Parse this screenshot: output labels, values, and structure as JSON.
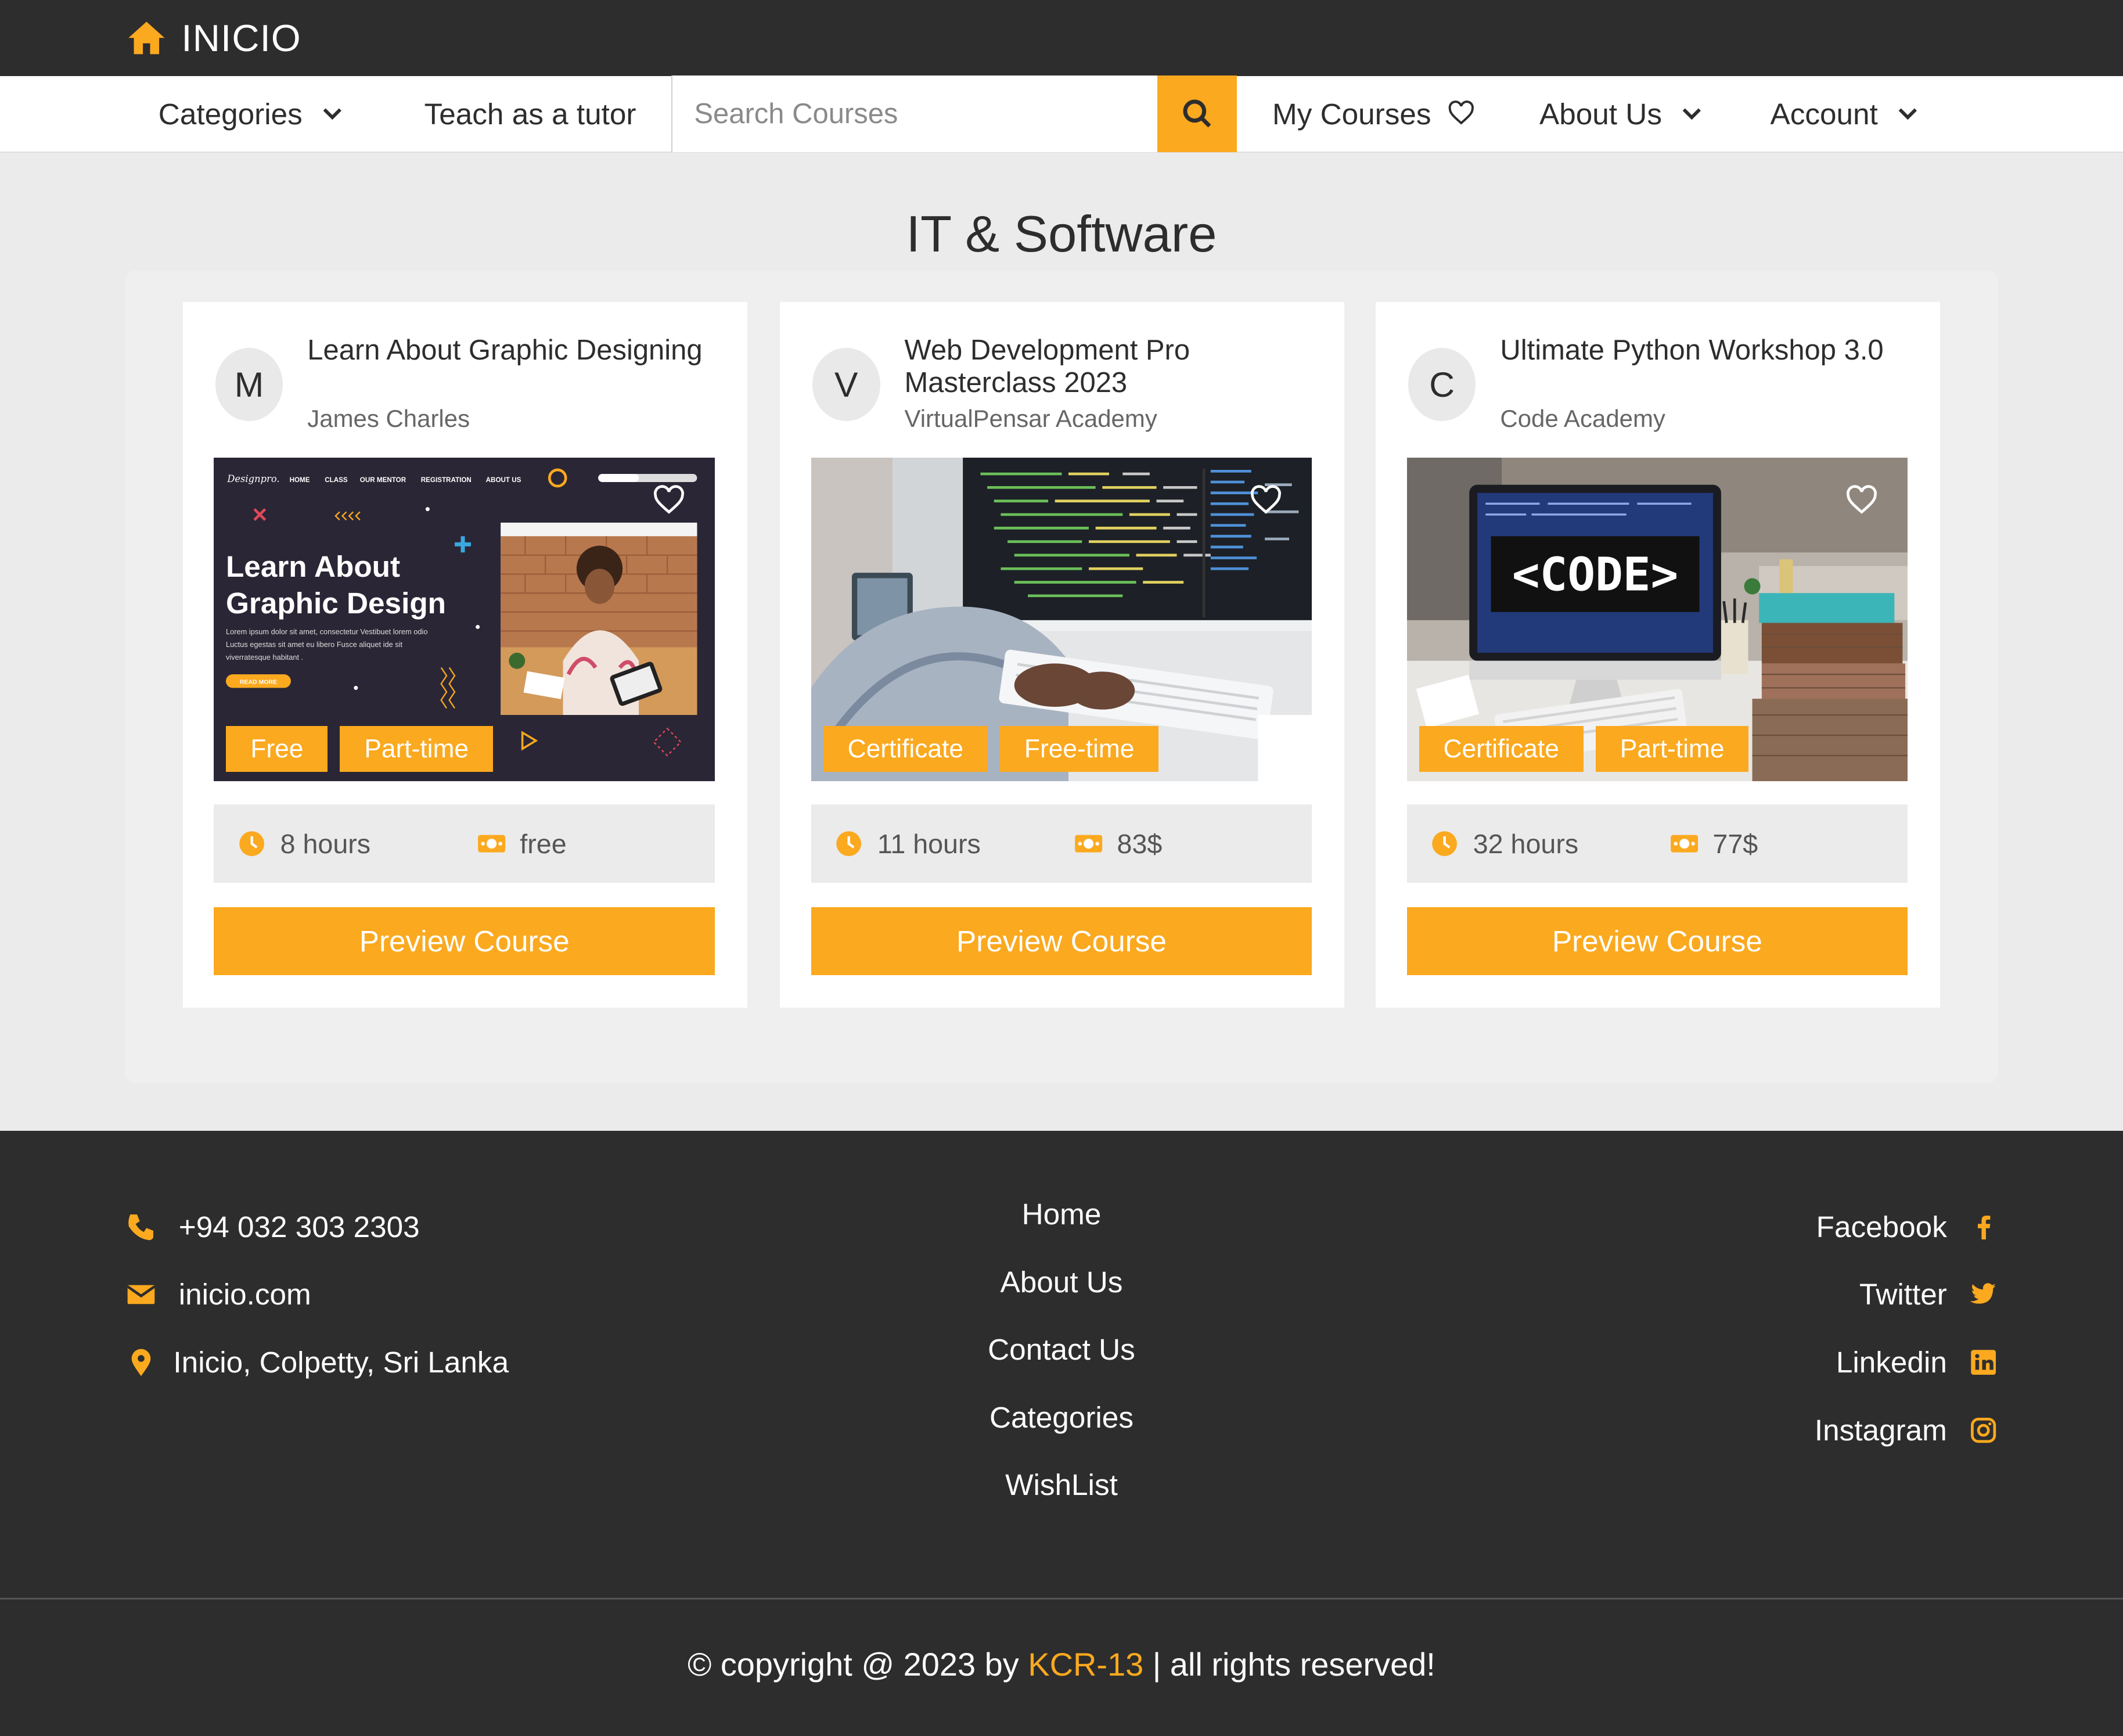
{
  "brand": {
    "name": "INICIO",
    "icon": "home-icon"
  },
  "nav": {
    "categories": "Categories",
    "teach": "Teach as a tutor",
    "search_placeholder": "Search Courses",
    "my_courses": "My Courses",
    "about": "About Us",
    "account": "Account"
  },
  "page": {
    "title": "IT & Software"
  },
  "courses": [
    {
      "avatar": "M",
      "title": "Learn About Graphic Designing",
      "author": "James Charles",
      "tags": [
        "Free",
        "Part-time"
      ],
      "hours": "8 hours",
      "price": "free",
      "cta": "Preview Course",
      "banner": {
        "brand": "Designpro.",
        "menu": [
          "HOME",
          "CLASS",
          "OUR MENTOR",
          "REGISTRATION",
          "ABOUT US"
        ],
        "headline_1": "Learn About",
        "headline_2": "Graphic Design",
        "body": "Lorem ipsum dolor sit amet, consectetur Vestibuet lorem odio Luctus egestas sit amet eu libero Fusce aliquet ide sit viverratesque habitant .",
        "button": "READ MORE"
      }
    },
    {
      "avatar": "V",
      "title": "Web Development Pro Masterclass 2023",
      "author": "VirtualPensar Academy",
      "tags": [
        "Certificate",
        "Free-time"
      ],
      "hours": "11 hours",
      "price": "83$",
      "cta": "Preview Course"
    },
    {
      "avatar": "C",
      "title": "Ultimate Python Workshop 3.0",
      "author": "Code Academy",
      "tags": [
        "Certificate",
        "Part-time"
      ],
      "hours": "32 hours",
      "price": "77$",
      "cta": "Preview Course",
      "screen_text": "<CODE>"
    }
  ],
  "footer": {
    "phone": "+94 032 303 2303",
    "email": "inicio.com",
    "address": "Inicio, Colpetty, Sri Lanka",
    "links": [
      "Home",
      "About Us",
      "Contact Us",
      "Categories",
      "WishList"
    ],
    "social": [
      "Facebook",
      "Twitter",
      "Linkedin",
      "Instagram"
    ],
    "copyright_pre": "© copyright @ 2023 by ",
    "copyright_brand": "KCR-13",
    "copyright_post": " | all rights reserved!"
  },
  "colors": {
    "accent": "#fba91f",
    "dark": "#2d2d2d",
    "background": "#ebebeb"
  }
}
